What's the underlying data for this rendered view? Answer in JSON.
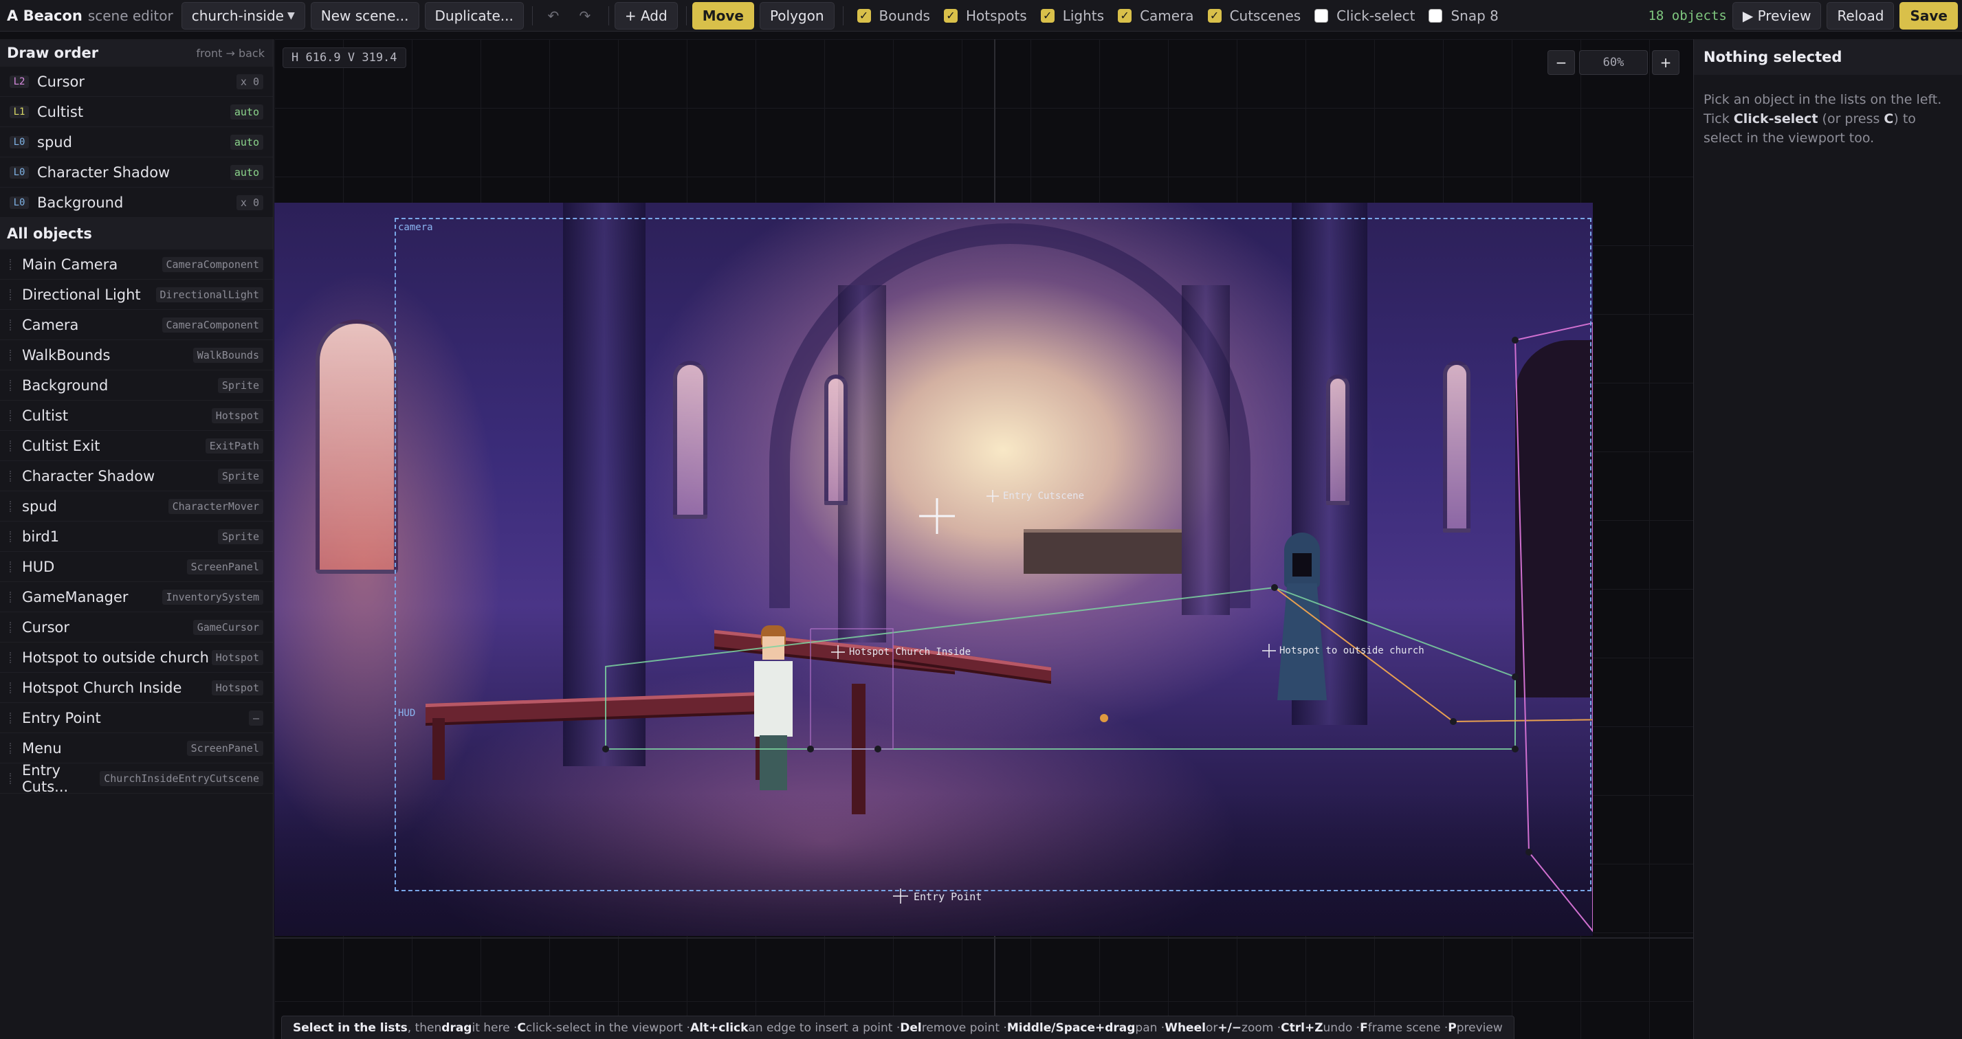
{
  "app": {
    "brand": "A Beacon",
    "subtitle": "scene editor"
  },
  "toolbar": {
    "scene": "church-inside",
    "new_scene": "New scene...",
    "duplicate": "Duplicate...",
    "undo_icon": "undo-icon",
    "redo_icon": "redo-icon",
    "add": "+ Add",
    "move": "Move",
    "polygon": "Polygon",
    "toggles": [
      {
        "label": "Bounds",
        "checked": true
      },
      {
        "label": "Hotspots",
        "checked": true
      },
      {
        "label": "Lights",
        "checked": true
      },
      {
        "label": "Camera",
        "checked": true
      },
      {
        "label": "Cutscenes",
        "checked": true
      },
      {
        "label": "Click-select",
        "checked": false
      },
      {
        "label": "Snap 8",
        "checked": false
      }
    ],
    "object_count": "18 objects",
    "preview": "▶ Preview",
    "reload": "Reload",
    "save": "Save",
    "accent": "#d9c04a"
  },
  "draw_order": {
    "title": "Draw order",
    "hint": "front → back",
    "items": [
      {
        "layer": "L2",
        "name": "Cursor",
        "badge": "x 0"
      },
      {
        "layer": "L1",
        "name": "Cultist",
        "badge": "auto"
      },
      {
        "layer": "L0",
        "name": "spud",
        "badge": "auto"
      },
      {
        "layer": "L0",
        "name": "Character Shadow",
        "badge": "auto"
      },
      {
        "layer": "L0",
        "name": "Background",
        "badge": "x 0"
      }
    ]
  },
  "all_objects": {
    "title": "All objects",
    "items": [
      {
        "name": "Main Camera",
        "type": "CameraComponent"
      },
      {
        "name": "Directional Light",
        "type": "DirectionalLight"
      },
      {
        "name": "Camera",
        "type": "CameraComponent"
      },
      {
        "name": "WalkBounds",
        "type": "WalkBounds"
      },
      {
        "name": "Background",
        "type": "Sprite"
      },
      {
        "name": "Cultist",
        "type": "Hotspot"
      },
      {
        "name": "Cultist Exit",
        "type": "ExitPath"
      },
      {
        "name": "Character Shadow",
        "type": "Sprite"
      },
      {
        "name": "spud",
        "type": "CharacterMover"
      },
      {
        "name": "bird1",
        "type": "Sprite"
      },
      {
        "name": "HUD",
        "type": "ScreenPanel"
      },
      {
        "name": "GameManager",
        "type": "InventorySystem"
      },
      {
        "name": "Cursor",
        "type": "GameCursor"
      },
      {
        "name": "Hotspot to outside church",
        "type": "Hotspot"
      },
      {
        "name": "Hotspot Church Inside",
        "type": "Hotspot"
      },
      {
        "name": "Entry Point",
        "type": "–"
      },
      {
        "name": "Menu",
        "type": "ScreenPanel"
      },
      {
        "name": "Entry Cuts...",
        "type": "ChurchInsideEntryCutscene"
      }
    ]
  },
  "viewport": {
    "coords": "H 616.9 V 319.4",
    "zoom": "60%",
    "zoom_out": "−",
    "zoom_in": "+",
    "labels": {
      "camera": "camera",
      "hud": "HUD",
      "entry_cutscene": "Entry Cutscene",
      "hotspot_inside": "Hotspot Church Inside",
      "hotspot_outside": "Hotspot to outside church",
      "entry_point": "Entry Point"
    },
    "colors": {
      "camera_rect": "#7aa7e8",
      "walk_bounds": "#7dd3a0",
      "exit_path": "#e8a050",
      "cutscene_poly": "#d070d0"
    }
  },
  "footer": {
    "parts": [
      [
        "b",
        "Select in the lists"
      ],
      [
        "t",
        ", then "
      ],
      [
        "b",
        "drag"
      ],
      [
        "t",
        " it here · "
      ],
      [
        "b",
        "C"
      ],
      [
        "t",
        " click-select in the viewport · "
      ],
      [
        "b",
        "Alt+click"
      ],
      [
        "t",
        " an edge to insert a point · "
      ],
      [
        "b",
        "Del"
      ],
      [
        "t",
        " remove point · "
      ],
      [
        "b",
        "Middle/Space+drag"
      ],
      [
        "t",
        " pan · "
      ],
      [
        "b",
        "Wheel"
      ],
      [
        "t",
        " or "
      ],
      [
        "b",
        "+/−"
      ],
      [
        "t",
        " zoom · "
      ],
      [
        "b",
        "Ctrl+Z"
      ],
      [
        "t",
        " undo · "
      ],
      [
        "b",
        "F"
      ],
      [
        "t",
        " frame scene · "
      ],
      [
        "b",
        "P"
      ],
      [
        "t",
        " preview"
      ]
    ]
  },
  "inspector": {
    "title": "Nothing selected",
    "line1": "Pick an object in the lists on the left.",
    "tick": "Tick ",
    "click_select": "Click-select",
    "or_press": " (or press ",
    "key_c": "C",
    "rest": ") to select in the viewport too."
  }
}
